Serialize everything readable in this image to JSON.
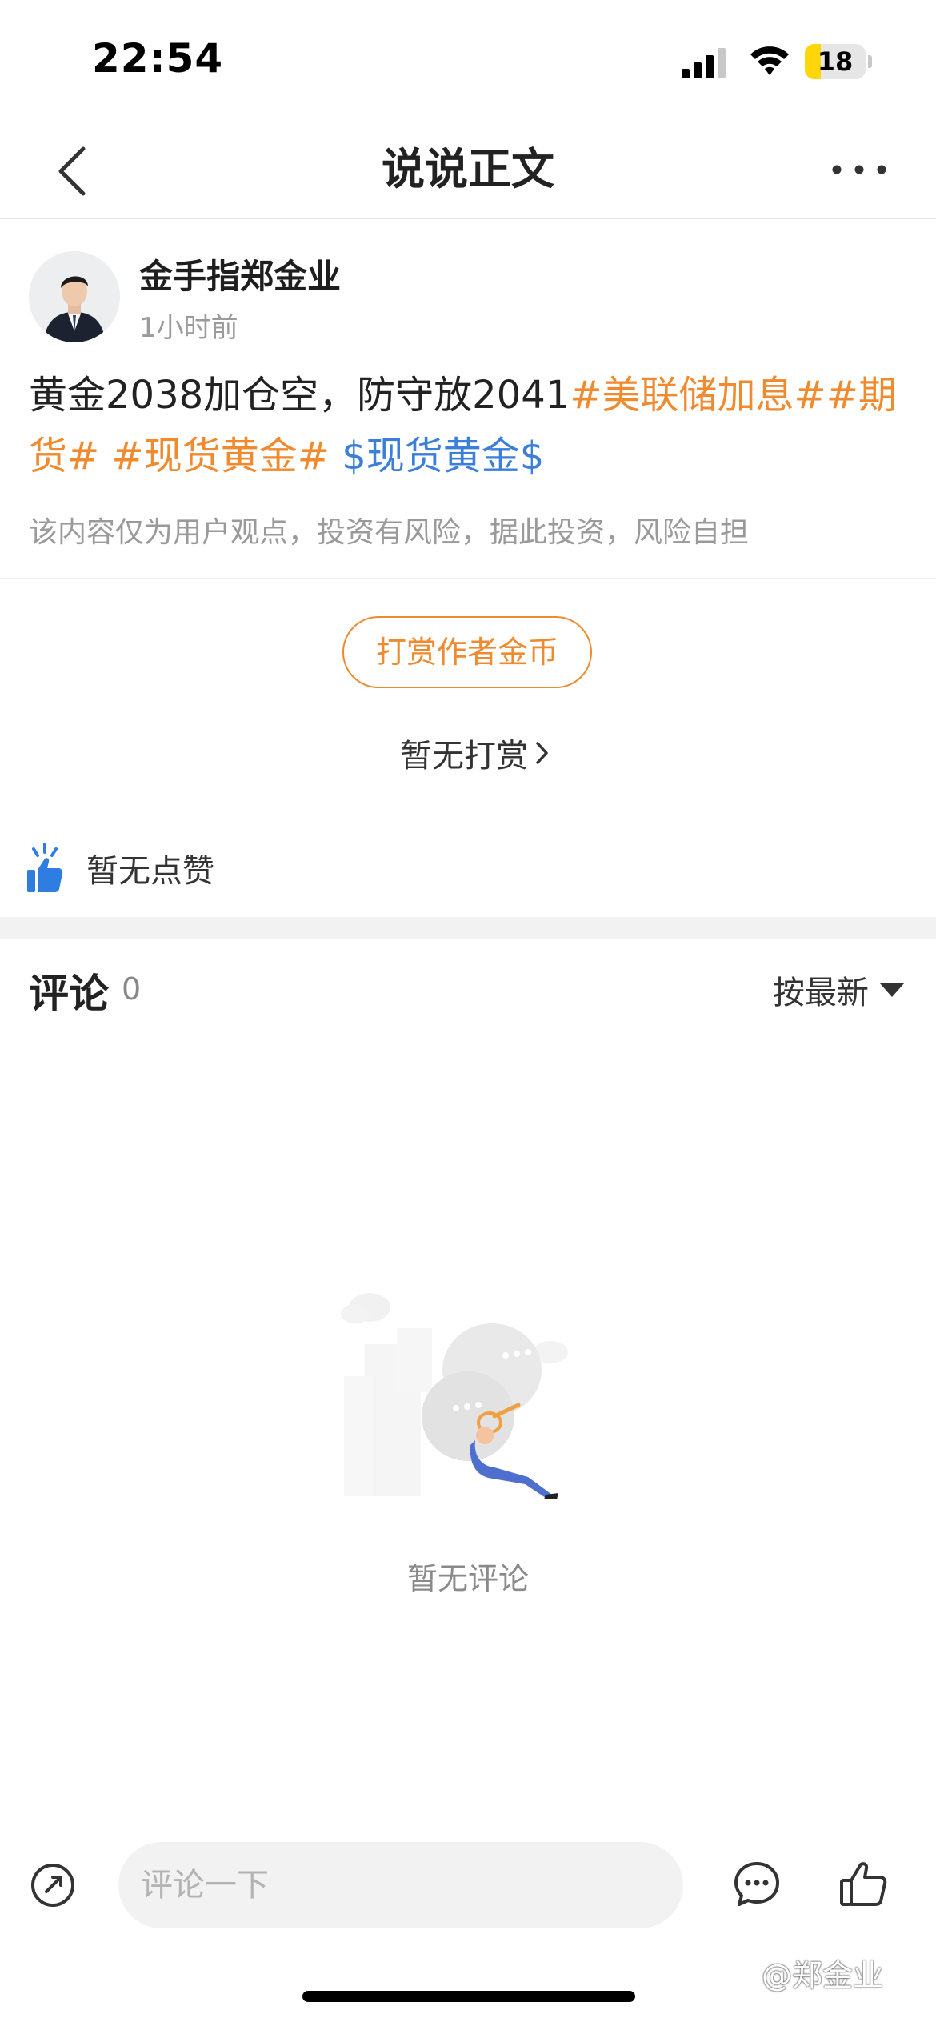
{
  "status_bar": {
    "time": "22:54",
    "battery_level": "18"
  },
  "nav": {
    "title": "说说正文"
  },
  "post": {
    "author": "金手指郑金业",
    "time": "1小时前",
    "content": [
      {
        "kind": "text",
        "text": "黄金2038加仓空，防守放2041"
      },
      {
        "kind": "tag",
        "text": "#美联储加息#"
      },
      {
        "kind": "tag",
        "text": "#期货#"
      },
      {
        "kind": "text",
        "text": " "
      },
      {
        "kind": "tag",
        "text": "#现货黄金#"
      },
      {
        "kind": "text",
        "text": " "
      },
      {
        "kind": "stock",
        "text": "$现货黄金$"
      }
    ],
    "disclaimer": "该内容仅为用户观点，投资有风险，据此投资，风险自担"
  },
  "tip": {
    "button_label": "打赏作者金币",
    "status": "暂无打赏"
  },
  "likes": {
    "status": "暂无点赞"
  },
  "comments": {
    "title": "评论",
    "count": "0",
    "sort_label": "按最新",
    "empty_text": "暂无评论"
  },
  "bottom_bar": {
    "input_placeholder": "评论一下"
  },
  "watermark": "@郑金业",
  "colors": {
    "tag": "#ef8a2e",
    "stock": "#3c7fd9",
    "like_accent": "#2f7de1"
  }
}
